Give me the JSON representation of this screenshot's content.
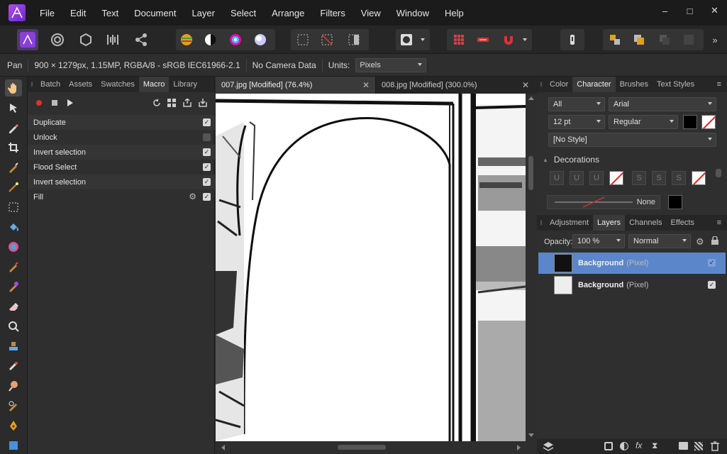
{
  "menubar": {
    "items": [
      "File",
      "Edit",
      "Text",
      "Document",
      "Layer",
      "Select",
      "Arrange",
      "Filters",
      "View",
      "Window",
      "Help"
    ],
    "window_controls": [
      "–",
      "□",
      "✕"
    ]
  },
  "context_bar": {
    "tool": "Pan",
    "doc_info": "900 × 1279px, 1.15MP, RGBA/8 - sRGB IEC61966-2.1",
    "camera": "No Camera Data",
    "units_label": "Units:",
    "units_value": "Pixels"
  },
  "left_panel": {
    "tabs": [
      "Batch",
      "Assets",
      "Swatches",
      "Macro",
      "Library"
    ],
    "active_tab": "Macro",
    "macro_steps": [
      {
        "label": "Duplicate",
        "checked": true,
        "gear": false
      },
      {
        "label": "Unlock",
        "checked": false,
        "gear": false
      },
      {
        "label": "Invert selection",
        "checked": true,
        "gear": false
      },
      {
        "label": "Flood Select",
        "checked": true,
        "gear": false
      },
      {
        "label": "Invert selection",
        "checked": true,
        "gear": false
      },
      {
        "label": "Fill",
        "checked": true,
        "gear": true
      }
    ]
  },
  "documents": {
    "tabs": [
      "007.jpg [Modified] (76.4%)",
      "008.jpg [Modified] (300.0%)"
    ],
    "active": 1
  },
  "right_top_panel": {
    "tabs": [
      "Color",
      "Character",
      "Brushes",
      "Text Styles"
    ],
    "active_tab": "Character",
    "scope": "All",
    "font": "Arial",
    "size": "12 pt",
    "weight": "Regular",
    "style": "[No Style]",
    "decorations_label": "Decorations",
    "underline_buttons": [
      "U",
      "U",
      "U"
    ],
    "strike_buttons": [
      "S",
      "S",
      "S"
    ],
    "line_style": "None"
  },
  "right_bottom_panel": {
    "tabs": [
      "Adjustment",
      "Layers",
      "Channels",
      "Effects"
    ],
    "active_tab": "Layers",
    "opacity_label": "Opacity:",
    "opacity_value": "100 %",
    "blend_mode": "Normal",
    "layers": [
      {
        "name": "Background",
        "type": "(Pixel)",
        "selected": true
      },
      {
        "name": "Background",
        "type": "(Pixel)",
        "selected": false
      }
    ]
  },
  "colors": {
    "accent_selected": "#5b86c9",
    "record": "#e0332b"
  }
}
